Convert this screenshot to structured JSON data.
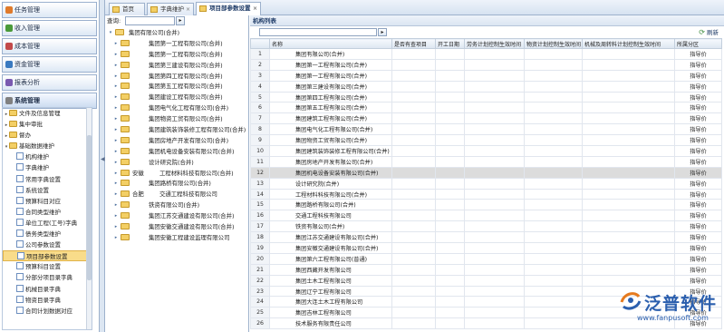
{
  "left_menu": {
    "sections": [
      "任务管理",
      "收入管理",
      "成本管理",
      "资金管理",
      "报表分析",
      "系统管理"
    ],
    "tree": [
      {
        "label": "文件及信息管理",
        "level": 0,
        "expanded": false
      },
      {
        "label": "集中审批",
        "level": 0,
        "expanded": false
      },
      {
        "label": "督办",
        "level": 0,
        "expanded": false
      },
      {
        "label": "基础数据维护",
        "level": 0,
        "expanded": true
      },
      {
        "label": "机构维护",
        "level": 1
      },
      {
        "label": "字典维护",
        "level": 1
      },
      {
        "label": "常用字典设置",
        "level": 1
      },
      {
        "label": "系统设置",
        "level": 1
      },
      {
        "label": "预算科目对应",
        "level": 1
      },
      {
        "label": "合同类型维护",
        "level": 1
      },
      {
        "label": "单位工程(工号)字典",
        "level": 1
      },
      {
        "label": "债务类型维护",
        "level": 1
      },
      {
        "label": "公司参数设置",
        "level": 1
      },
      {
        "label": "项目部参数设置",
        "level": 1,
        "selected": true
      },
      {
        "label": "预算科目设置",
        "level": 1
      },
      {
        "label": "分部分项目录字典",
        "level": 1
      },
      {
        "label": "机械目录字典",
        "level": 1
      },
      {
        "label": "物资目录字典",
        "level": 1
      },
      {
        "label": "合同计划数据对应",
        "level": 1
      }
    ]
  },
  "tabs": [
    {
      "label": "首页",
      "active": false
    },
    {
      "label": "字典维护",
      "active": false
    },
    {
      "label": "项目部参数设置",
      "active": true
    }
  ],
  "middle": {
    "query_label": "查询:",
    "query_button": "▸",
    "tree": [
      {
        "label": "集团有限公司(合并)",
        "indent": 1,
        "root": true
      },
      {
        "label": "集团第一工程有限公司(合并)",
        "indent": 2
      },
      {
        "label": "集团第一工程有限公司(合并)",
        "indent": 2
      },
      {
        "label": "集团第三建设有限公司(合并)",
        "indent": 2
      },
      {
        "label": "集团第四工程有限公司(合并)",
        "indent": 2
      },
      {
        "label": "集团第五工程有限公司(合并)",
        "indent": 2
      },
      {
        "label": "集团建设工程有限公司(合并)",
        "indent": 2
      },
      {
        "label": "集团电气化工程有限公司(合并)",
        "indent": 2
      },
      {
        "label": "集团物资工贸有限公司(合并)",
        "indent": 2
      },
      {
        "label": "集团建筑装饰装修工程有限公司(合并)",
        "indent": 2
      },
      {
        "label": "集团房地产开发有限公司(合并)",
        "indent": 2
      },
      {
        "label": "集团机电设备安装有限公司(合并)",
        "indent": 2
      },
      {
        "label": "设计研究院(合并)",
        "indent": 2
      },
      {
        "label": "安徽",
        "extra": "工程材料科技有限公司(合并)",
        "indent": 2
      },
      {
        "label": "集团路桥有限公司(合并)",
        "indent": 2
      },
      {
        "label": "合肥",
        "extra": "交通工程科技有限公司",
        "indent": 2
      },
      {
        "label": "铁资有限公司(合并)",
        "indent": 2
      },
      {
        "label": "集团江苏交通建设有限公司(合并)",
        "indent": 2
      },
      {
        "label": "集团安徽交通建设有限公司(合并)",
        "indent": 2
      },
      {
        "label": "集团安徽工程建设监理有限公司",
        "indent": 2
      }
    ]
  },
  "right": {
    "title": "机构列表",
    "refresh_label": "刷新",
    "search_button": "▸",
    "columns": [
      "",
      "名称",
      "是否有查项目",
      "开工日期",
      "劳务计划控制生效时间",
      "物资计划控制生效时间",
      "机械及周转料计划控制生效时间",
      "所属分区"
    ],
    "rows": [
      {
        "n": "1",
        "name": "集团有限公司(合并)",
        "div": "指导价"
      },
      {
        "n": "2",
        "name": "集团第一工程有限公司(合并)",
        "div": "指导价"
      },
      {
        "n": "3",
        "name": "集团第一工程有限公司(合并)",
        "div": "指导价"
      },
      {
        "n": "4",
        "name": "集团第三建设有限公司(合并)",
        "div": "指导价"
      },
      {
        "n": "5",
        "name": "集团第四工程有限公司(合并)",
        "div": "指导价"
      },
      {
        "n": "6",
        "name": "集团第五工程有限公司(合并)",
        "div": "指导价"
      },
      {
        "n": "7",
        "name": "集团建筑工程有限公司(合并)",
        "div": "指导价"
      },
      {
        "n": "8",
        "name": "集团电气化工程有限公司(合并)",
        "div": "指导价"
      },
      {
        "n": "9",
        "name": "集团物资工贸有限公司(合并)",
        "div": "指导价"
      },
      {
        "n": "10",
        "name": "集团建筑装饰装修工程有限公司(合并)",
        "div": "指导价"
      },
      {
        "n": "11",
        "name": "集团房地产开发有限公司(合并)",
        "div": "指导价"
      },
      {
        "n": "12",
        "name": "集团机电设备安装有限公司(合并)",
        "div": "指导价",
        "selected": true
      },
      {
        "n": "13",
        "name": "设计研究院(合并)",
        "div": "指导价"
      },
      {
        "n": "14",
        "name": "工程材料科技有限公司(合并)",
        "div": "指导价"
      },
      {
        "n": "15",
        "name": "集团路桥有限公司(合并)",
        "div": "指导价"
      },
      {
        "n": "16",
        "name": "交通工程科技有限公司",
        "div": "指导价"
      },
      {
        "n": "17",
        "name": "铁资有限公司(合并)",
        "div": "指导价"
      },
      {
        "n": "18",
        "name": "集团江苏交通建设有限公司(合并)",
        "div": "指导价"
      },
      {
        "n": "19",
        "name": "集团安徽交通建设有限公司(合并)",
        "div": "指导价"
      },
      {
        "n": "20",
        "name": "集团第六工程有限公司(普通)",
        "div": "指导价"
      },
      {
        "n": "21",
        "name": "集团西藏开发有限公司",
        "div": "指导价"
      },
      {
        "n": "22",
        "name": "集团土木工程有限公司",
        "div": "指导价"
      },
      {
        "n": "23",
        "name": "集团辽宁工程有限公司",
        "div": "指导价"
      },
      {
        "n": "24",
        "name": "集团大连土木工程有限公司",
        "div": "指导价"
      },
      {
        "n": "25",
        "name": "集团吉林工程有限公司",
        "div": "指导价"
      },
      {
        "n": "26",
        "name": "技术服务有限责任公司",
        "div": "指导价"
      }
    ]
  },
  "watermark": {
    "brand": "泛普软件",
    "url": "www.fanpusoft.com"
  }
}
